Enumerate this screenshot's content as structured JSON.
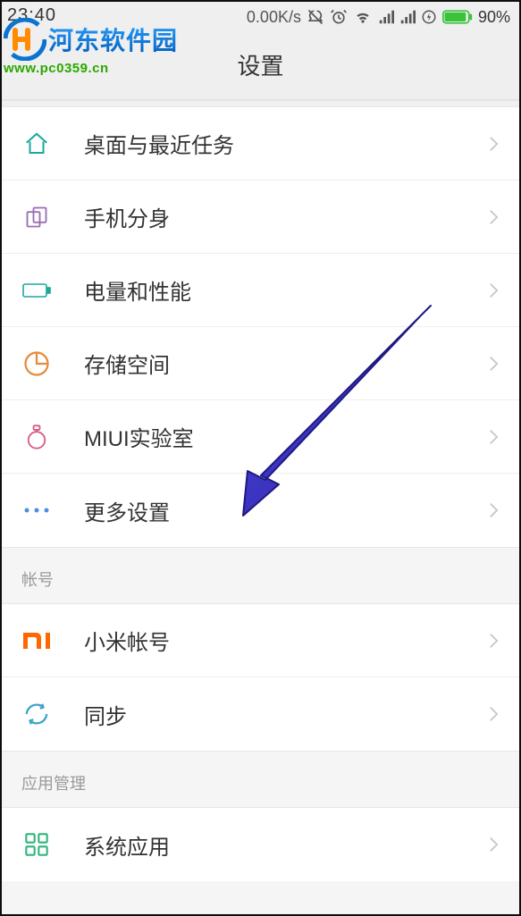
{
  "status_bar": {
    "time": "23:40",
    "net_speed": "0.00K/s",
    "battery_pct": "90%"
  },
  "watermark": {
    "title": "河东软件园",
    "url": "www.pc0359.cn"
  },
  "header": {
    "title": "设置"
  },
  "groups": [
    {
      "header": null,
      "items": [
        {
          "icon": "home",
          "label": "桌面与最近任务"
        },
        {
          "icon": "clone",
          "label": "手机分身"
        },
        {
          "icon": "battery",
          "label": "电量和性能"
        },
        {
          "icon": "storage",
          "label": "存储空间"
        },
        {
          "icon": "lab",
          "label": "MIUI实验室"
        },
        {
          "icon": "more",
          "label": "更多设置"
        }
      ]
    },
    {
      "header": "帐号",
      "items": [
        {
          "icon": "mi",
          "label": "小米帐号"
        },
        {
          "icon": "sync",
          "label": "同步"
        }
      ]
    },
    {
      "header": "应用管理",
      "items": [
        {
          "icon": "apps",
          "label": "系统应用"
        }
      ]
    }
  ],
  "annotation": {
    "arrow_color": "#3a34c9",
    "target_item": "更多设置"
  }
}
